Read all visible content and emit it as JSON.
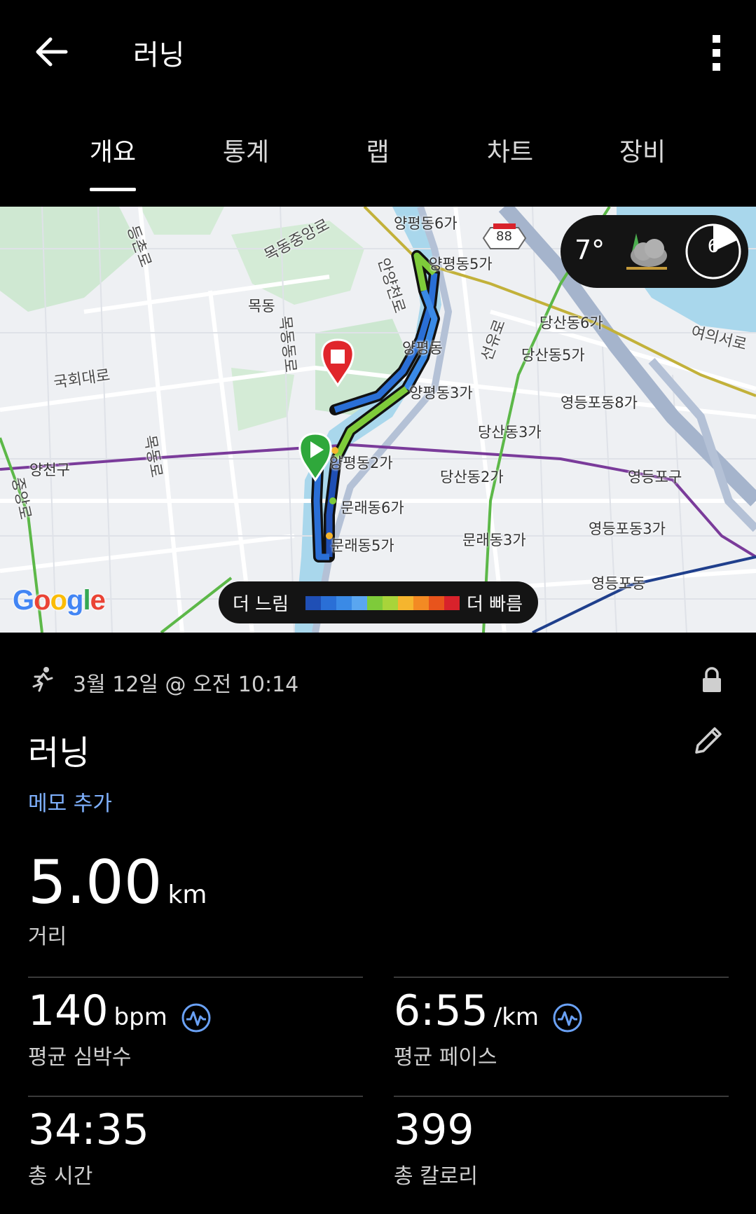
{
  "header": {
    "title": "러닝"
  },
  "tabs": [
    {
      "label": "개요"
    },
    {
      "label": "통계"
    },
    {
      "label": "랩"
    },
    {
      "label": "차트"
    },
    {
      "label": "장비"
    }
  ],
  "map": {
    "labels": [
      "양평동6가",
      "목동중앙로",
      "등촌로",
      "88",
      "양평동5가",
      "안양천로",
      "목동",
      "당산동6가",
      "여의서로",
      "당산동5가",
      "양평동",
      "선유로",
      "국회대로",
      "목동동로",
      "양평동3가",
      "영등포동8가",
      "양천구",
      "목동로",
      "당산동3가",
      "양평동2가",
      "당산동2가",
      "영등포구",
      "중앙로",
      "문래동6가",
      "영등포동3가",
      "문래동5가",
      "문래동3가",
      "영등포동"
    ],
    "weather": {
      "temp": "7°",
      "wind": "6"
    },
    "legend": {
      "slow": "더 느림",
      "fast": "더 빠름",
      "colors": [
        "#1f4fb5",
        "#2a6fd6",
        "#3a8ae6",
        "#5aa6f0",
        "#7ecb3a",
        "#a8d43a",
        "#f5b52e",
        "#f38a23",
        "#e8541c",
        "#d8222b"
      ]
    },
    "google": "Google",
    "route_colors": {
      "slow": "#2a6fd6",
      "mid": "#7ecb3a",
      "fast": "#f5b52e"
    }
  },
  "activity": {
    "date": "3월 12일 @ 오전 10:14",
    "title": "러닝",
    "memo": "메모 추가",
    "distance": {
      "value": "5.00",
      "unit": "km",
      "label": "거리"
    },
    "stats": [
      {
        "value": "140",
        "unit": "bpm",
        "label": "평균 심박수"
      },
      {
        "value": "6:55",
        "unit": "/km",
        "label": "평균 페이스"
      },
      {
        "value": "34:35",
        "unit": "",
        "label": "총 시간"
      },
      {
        "value": "399",
        "unit": "",
        "label": "총 칼로리"
      }
    ]
  }
}
